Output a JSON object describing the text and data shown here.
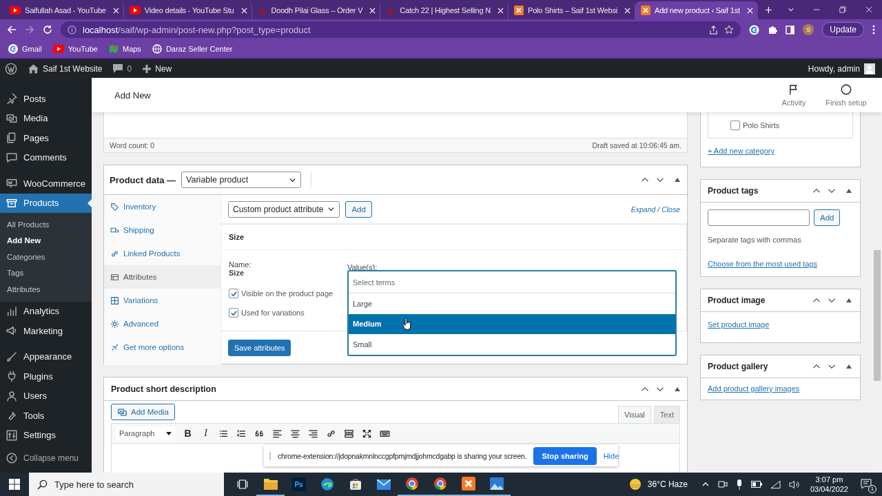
{
  "browser": {
    "tabs": [
      {
        "title": "Saifullah Asad - YouTube",
        "kind": "youtube",
        "selected": false
      },
      {
        "title": "Video details - YouTube Stu",
        "kind": "youtube",
        "selected": false
      },
      {
        "title": "Doodh Pilai Glass – Order V",
        "kind": "shop",
        "selected": false
      },
      {
        "title": "Catch 22 | Highest Selling N",
        "kind": "shop",
        "selected": false
      },
      {
        "title": "Polo Shirts – Saif 1st Websi",
        "kind": "xampp",
        "selected": false
      },
      {
        "title": "Add new product ‹ Saif 1st",
        "kind": "xampp",
        "selected": true
      }
    ],
    "url_host": "localhost",
    "url_path": "/saif/wp-admin/post-new.php?post_type=product",
    "profile": "S",
    "update": "Update",
    "bookmarks": [
      {
        "label": "Gmail",
        "kind": "google"
      },
      {
        "label": "YouTube",
        "kind": "youtube"
      },
      {
        "label": "Maps",
        "kind": "maps"
      },
      {
        "label": "Daraz Seller Center",
        "kind": "globe"
      }
    ]
  },
  "admin_bar": {
    "site": "Saif 1st Website",
    "comments": "0",
    "new": "New",
    "greeting": "Howdy, admin"
  },
  "sidebar": {
    "groups": [
      [
        {
          "label": "Posts",
          "kind": "pin",
          "selected": false
        },
        {
          "label": "Media",
          "kind": "media",
          "selected": false
        },
        {
          "label": "Pages",
          "kind": "pages",
          "selected": false
        },
        {
          "label": "Comments",
          "kind": "comment",
          "selected": false
        }
      ],
      [
        {
          "label": "WooCommerce",
          "kind": "woo",
          "selected": false
        },
        {
          "label": "Products",
          "kind": "box",
          "selected": true,
          "children": [
            {
              "label": "All Products",
              "selected": false
            },
            {
              "label": "Add New",
              "selected": true
            },
            {
              "label": "Categories",
              "selected": false
            },
            {
              "label": "Tags",
              "selected": false
            },
            {
              "label": "Attributes",
              "selected": false
            }
          ]
        },
        {
          "label": "Analytics",
          "kind": "bars",
          "selected": false
        },
        {
          "label": "Marketing",
          "kind": "megaphone",
          "selected": false
        }
      ],
      [
        {
          "label": "Appearance",
          "kind": "brush",
          "selected": false
        },
        {
          "label": "Plugins",
          "kind": "plug",
          "selected": false
        },
        {
          "label": "Users",
          "kind": "user",
          "selected": false
        },
        {
          "label": "Tools",
          "kind": "wrench",
          "selected": false
        },
        {
          "label": "Settings",
          "kind": "sliders",
          "selected": false
        }
      ]
    ],
    "collapse": "Collapse menu"
  },
  "header": {
    "title": "Add New",
    "actions": [
      {
        "label": "Activity",
        "kind": "flag"
      },
      {
        "label": "Finish setup",
        "kind": "circle"
      }
    ]
  },
  "editor": {
    "word_count": "Word count: 0",
    "draft_status": "Draft saved at 10:06:45 am."
  },
  "product_data": {
    "title": "Product data —",
    "type": "Variable product",
    "tabs": [
      {
        "label": "Inventory",
        "kind": "tag",
        "selected": false
      },
      {
        "label": "Shipping",
        "kind": "truck",
        "selected": false
      },
      {
        "label": "Linked Products",
        "kind": "link",
        "selected": false
      },
      {
        "label": "Attributes",
        "kind": "table",
        "selected": true
      },
      {
        "label": "Variations",
        "kind": "grid",
        "selected": false
      },
      {
        "label": "Advanced",
        "kind": "gear",
        "selected": false
      },
      {
        "label": "Get more options",
        "kind": "plugin",
        "selected": false
      }
    ],
    "attribute_select": "Custom product attribute",
    "add": "Add",
    "expand_close": "Expand / Close",
    "attribute": {
      "title": "Size",
      "name_label": "Name:",
      "name": "Size",
      "values_label": "Value(s):",
      "options": [
        {
          "label": "Visible on the product page",
          "checked": true
        },
        {
          "label": "Used for variations",
          "checked": true
        }
      ]
    },
    "save": "Save attributes",
    "dropdown": {
      "placeholder": "Select terms",
      "options": [
        {
          "label": "Large",
          "selected": false
        },
        {
          "label": "Medium",
          "selected": true
        },
        {
          "label": "Small",
          "selected": false
        }
      ]
    }
  },
  "short_description": {
    "title": "Product short description",
    "add_media": "Add Media",
    "editor_tabs": [
      {
        "label": "Visual",
        "selected": true
      },
      {
        "label": "Text",
        "selected": false
      }
    ],
    "format": "Paragraph",
    "toolbar": [
      {
        "kind": "bold",
        "label": "B"
      },
      {
        "kind": "italic",
        "label": "I"
      },
      {
        "kind": "bullets"
      },
      {
        "kind": "numbers"
      },
      {
        "kind": "quote"
      },
      {
        "kind": "align-left"
      },
      {
        "kind": "align-center"
      },
      {
        "kind": "align-right"
      },
      {
        "kind": "link"
      },
      {
        "kind": "more"
      },
      {
        "kind": "fullscreen"
      },
      {
        "kind": "keyboard"
      }
    ]
  },
  "categories": {
    "items": [
      {
        "label": "Polo Shirts",
        "checked": false
      }
    ],
    "add_link": "+ Add new category"
  },
  "tags": {
    "title": "Product tags",
    "add": "Add",
    "hint": "Separate tags with commas",
    "link": "Choose from the most used tags"
  },
  "image": {
    "title": "Product image",
    "link": "Set product image"
  },
  "gallery": {
    "title": "Product gallery",
    "link": "Add product gallery images"
  },
  "share_bar": {
    "message": "chrome-extension://jdopnakmnlnccgpfpmjmdjjohmcdgabp is sharing your screen.",
    "stop": "Stop sharing",
    "hide": "Hide"
  },
  "taskbar": {
    "search": "Type here to search",
    "apps": [
      {
        "kind": "taskview",
        "active": false
      },
      {
        "kind": "folder",
        "active": true
      },
      {
        "kind": "ps",
        "label": "Ps",
        "active": false
      },
      {
        "kind": "edge",
        "active": false
      },
      {
        "kind": "store",
        "active": false
      },
      {
        "kind": "mail",
        "active": false
      },
      {
        "kind": "chrome",
        "active": true
      },
      {
        "kind": "chrome",
        "active": true
      },
      {
        "kind": "xampp",
        "active": true
      },
      {
        "kind": "photos",
        "active": true
      }
    ],
    "weather": "36°C Haze",
    "time": "3:07 pm",
    "date": "03/04/2022",
    "notifications": "1"
  }
}
